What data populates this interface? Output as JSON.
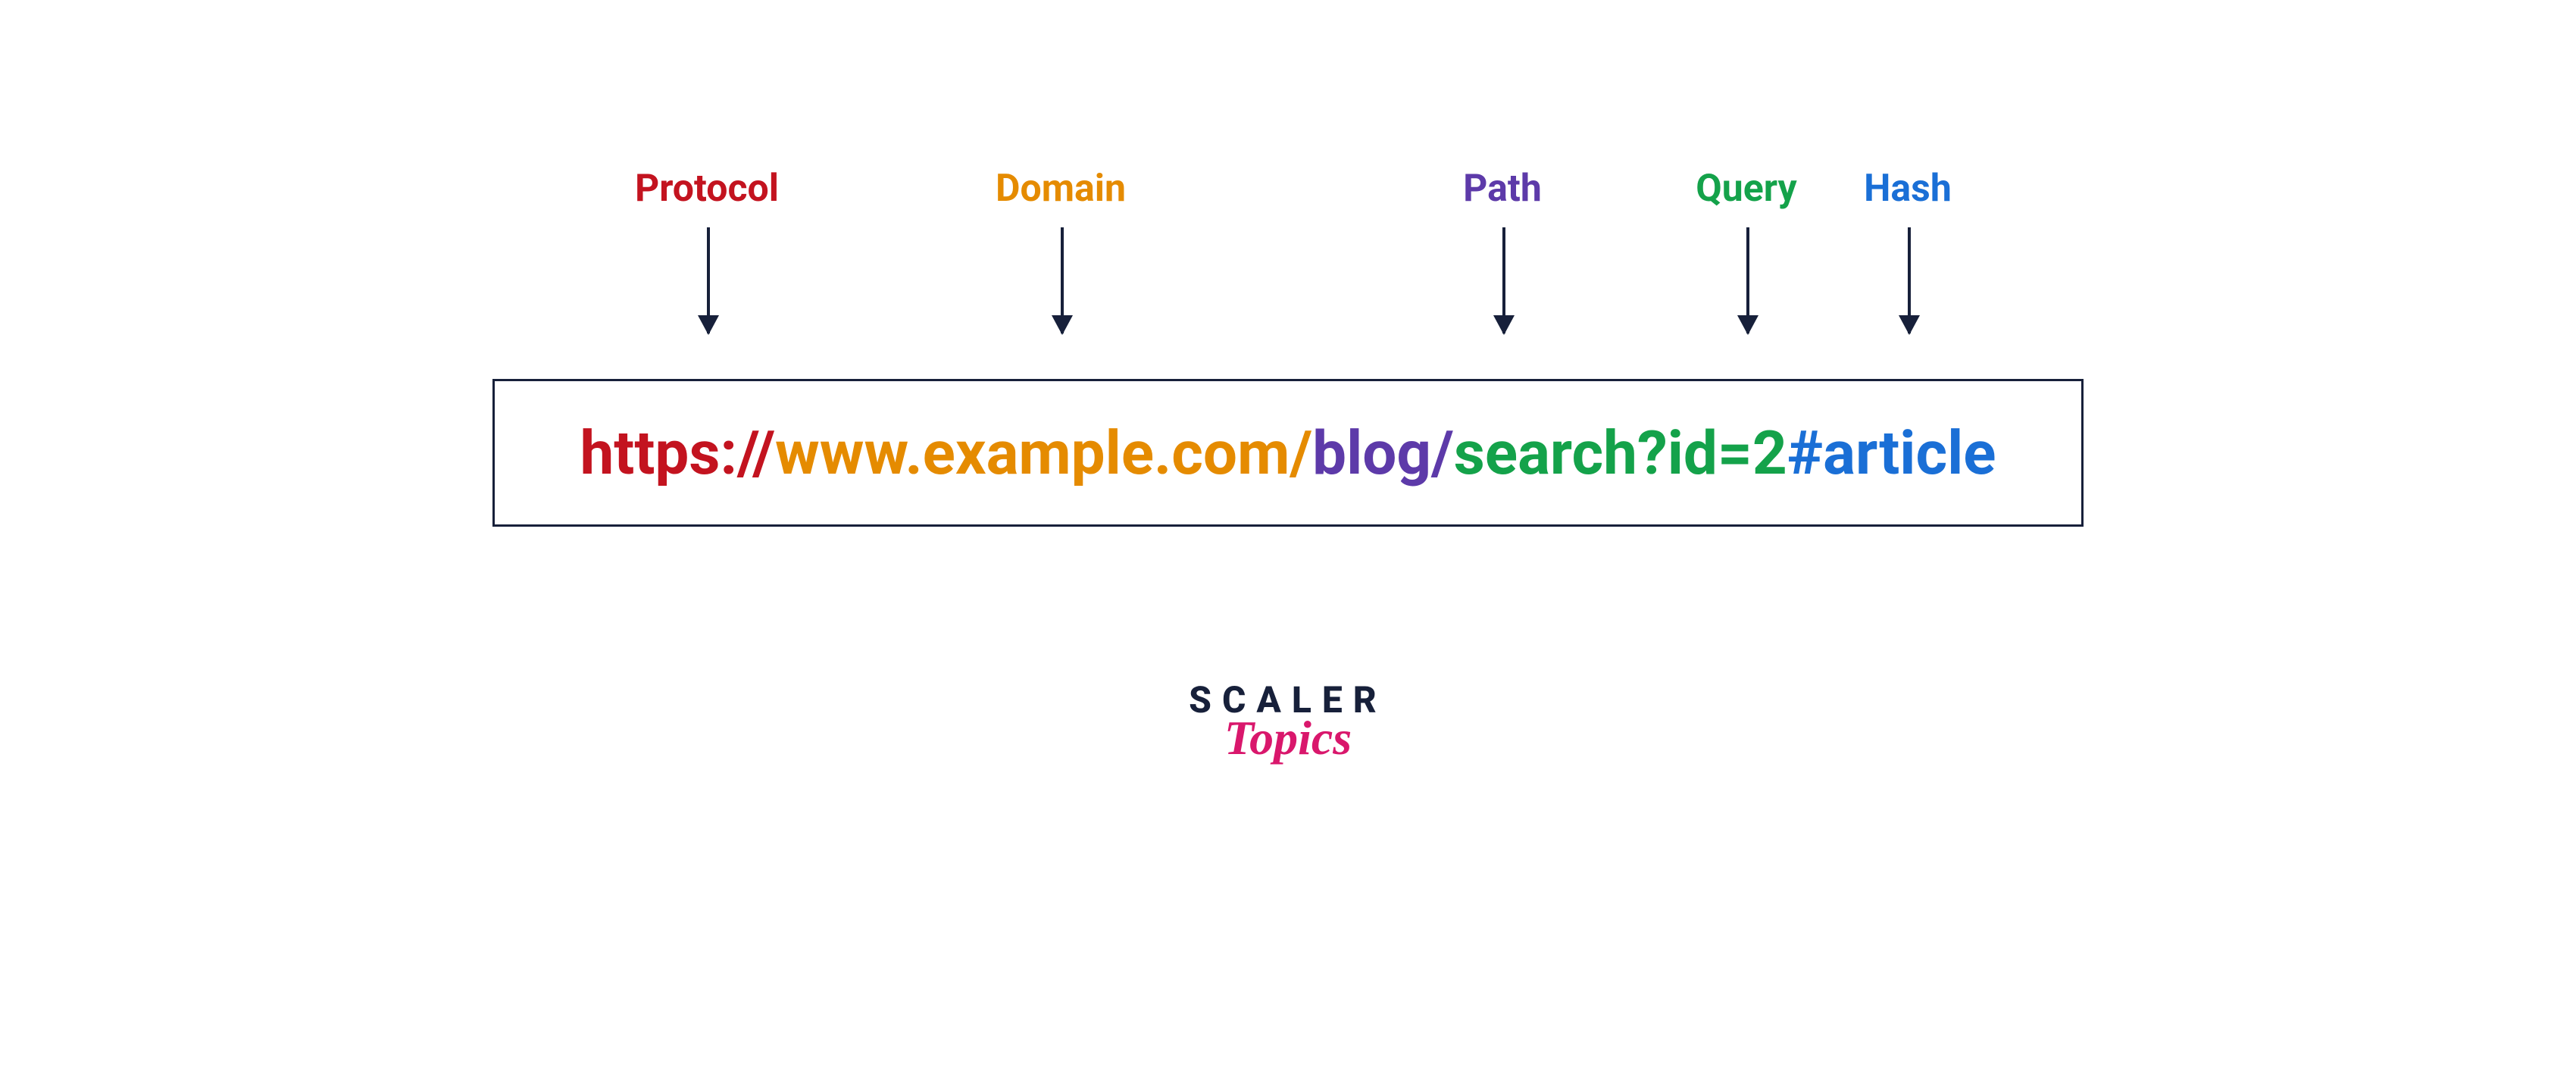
{
  "diagram": {
    "labels": {
      "protocol": "Protocol",
      "domain": "Domain",
      "path": "Path",
      "query": "Query",
      "hash": "Hash"
    },
    "url_parts": {
      "protocol": "https://",
      "domain": "www.example.com",
      "sep1": "/",
      "path": "blog",
      "sep2": "/",
      "query": "search?id=2",
      "hash": "#article"
    },
    "colors": {
      "protocol": "#c3131f",
      "domain": "#e58b00",
      "path": "#5d3aa9",
      "query": "#14a24a",
      "hash": "#1a6fd6",
      "arrow": "#17203a",
      "box_border": "#17203a"
    }
  },
  "brand": {
    "line1": "SCALER",
    "line2": "Topics",
    "line1_color": "#17203a",
    "line2_color": "#d9176c"
  }
}
